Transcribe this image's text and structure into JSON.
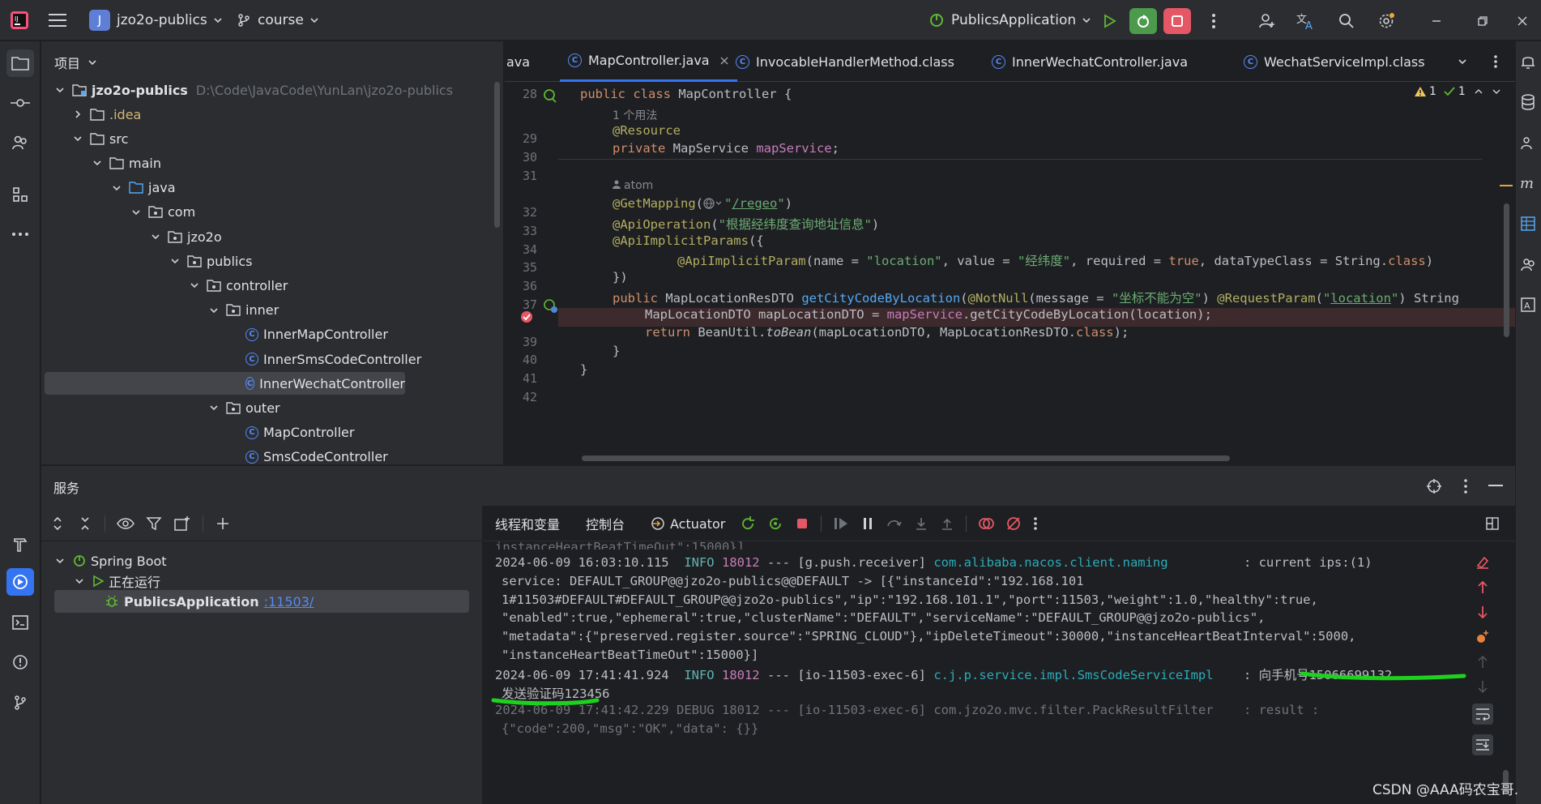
{
  "titlebar": {
    "project_initial": "J",
    "project_name": "jzo2o-publics",
    "branch": "course",
    "run_config": "PublicsApplication"
  },
  "project_panel": {
    "title": "项目",
    "root_name": "jzo2o-publics",
    "root_path": "D:\\Code\\JavaCode\\YunLan\\jzo2o-publics",
    "tree": [
      {
        "label": ".idea",
        "kind": "folder",
        "depth": 1,
        "expanded": false
      },
      {
        "label": "src",
        "kind": "folder",
        "depth": 1,
        "expanded": true
      },
      {
        "label": "main",
        "kind": "folder",
        "depth": 2,
        "expanded": true
      },
      {
        "label": "java",
        "kind": "folder",
        "depth": 3,
        "expanded": true
      },
      {
        "label": "com",
        "kind": "package",
        "depth": 4,
        "expanded": true
      },
      {
        "label": "jzo2o",
        "kind": "package",
        "depth": 5,
        "expanded": true
      },
      {
        "label": "publics",
        "kind": "package",
        "depth": 6,
        "expanded": true
      },
      {
        "label": "controller",
        "kind": "package",
        "depth": 7,
        "expanded": true
      },
      {
        "label": "inner",
        "kind": "package",
        "depth": 8,
        "expanded": true
      },
      {
        "label": "InnerMapController",
        "kind": "class",
        "depth": 9
      },
      {
        "label": "InnerSmsCodeController",
        "kind": "class",
        "depth": 9
      },
      {
        "label": "InnerWechatController",
        "kind": "class",
        "depth": 9,
        "selected": true
      },
      {
        "label": "outer",
        "kind": "package",
        "depth": 8,
        "expanded": true
      },
      {
        "label": "MapController",
        "kind": "class",
        "depth": 9
      },
      {
        "label": "SmsCodeController",
        "kind": "class",
        "depth": 9
      }
    ]
  },
  "editor": {
    "tabs": [
      {
        "label": "ava",
        "active": false,
        "icon": false
      },
      {
        "label": "MapController.java",
        "active": true,
        "icon": true,
        "closable": true
      },
      {
        "label": "InvocableHandlerMethod.class",
        "active": false,
        "icon": true
      },
      {
        "label": "InnerWechatController.java",
        "active": false,
        "icon": true
      },
      {
        "label": "WechatServiceImpl.class",
        "active": false,
        "icon": true
      }
    ],
    "inspections": {
      "warnings": "1",
      "ok": "1"
    },
    "usage_hint": "1 个用法",
    "author_hint": "atom",
    "line_numbers": [
      "28",
      "29",
      "30",
      "31",
      "32",
      "33",
      "34",
      "35",
      "36",
      "37",
      "38",
      "39",
      "40",
      "41",
      "42"
    ]
  },
  "services": {
    "title": "服务",
    "tree": {
      "root": "Spring Boot",
      "group": "正在运行",
      "app": "PublicsApplication",
      "port_link": ":11503/"
    },
    "tabs": [
      "线程和变量",
      "控制台",
      "Actuator"
    ]
  },
  "console": {
    "truncated_top": "instanceHeartBeatTimeOut\":15000}]",
    "lines": [
      {
        "time": "2024-06-09 16:03:10.115",
        "level": "INFO",
        "pid": "18012",
        "thread": "[g.push.receiver]",
        "logger": "com.alibaba.nacos.client.naming",
        "msg": ": current ips:(1)"
      },
      {
        "cont": "service: DEFAULT_GROUP@@jzo2o-publics@@DEFAULT -> [{\"instanceId\":\"192.168.101"
      },
      {
        "cont": "1#11503#DEFAULT#DEFAULT_GROUP@@jzo2o-publics\",\"ip\":\"192.168.101.1\",\"port\":11503,\"weight\":1.0,\"healthy\":true,"
      },
      {
        "cont": "\"enabled\":true,\"ephemeral\":true,\"clusterName\":\"DEFAULT\",\"serviceName\":\"DEFAULT_GROUP@@jzo2o-publics\","
      },
      {
        "cont": "\"metadata\":{\"preserved.register.source\":\"SPRING_CLOUD\"},\"ipDeleteTimeout\":30000,\"instanceHeartBeatInterval\":5000,"
      },
      {
        "cont": "\"instanceHeartBeatTimeOut\":15000}]"
      },
      {
        "time": "2024-06-09 17:41:41.924",
        "level": "INFO",
        "pid": "18012",
        "thread": "[io-11503-exec-6]",
        "logger": "c.j.p.service.impl.SmsCodeServiceImpl",
        "msg": ": 向手机号15066699132"
      },
      {
        "cont": "发送验证码123456"
      },
      {
        "time": "2024-06-09 17:41:42.229",
        "level": "DEBUG",
        "pid": "18012",
        "thread": "[io-11503-exec-6]",
        "logger": "com.jzo2o.mvc.filter.PackResultFilter",
        "msg": ": result :"
      },
      {
        "cont": "{\"code\":200,\"msg\":\"OK\",\"data\": {}}"
      }
    ]
  },
  "watermark": "CSDN @AAA码农宝哥.",
  "colors": {
    "accent": "#3574f0",
    "highlight_marks": "#1fd11f",
    "breakpoint": "#e55765"
  }
}
